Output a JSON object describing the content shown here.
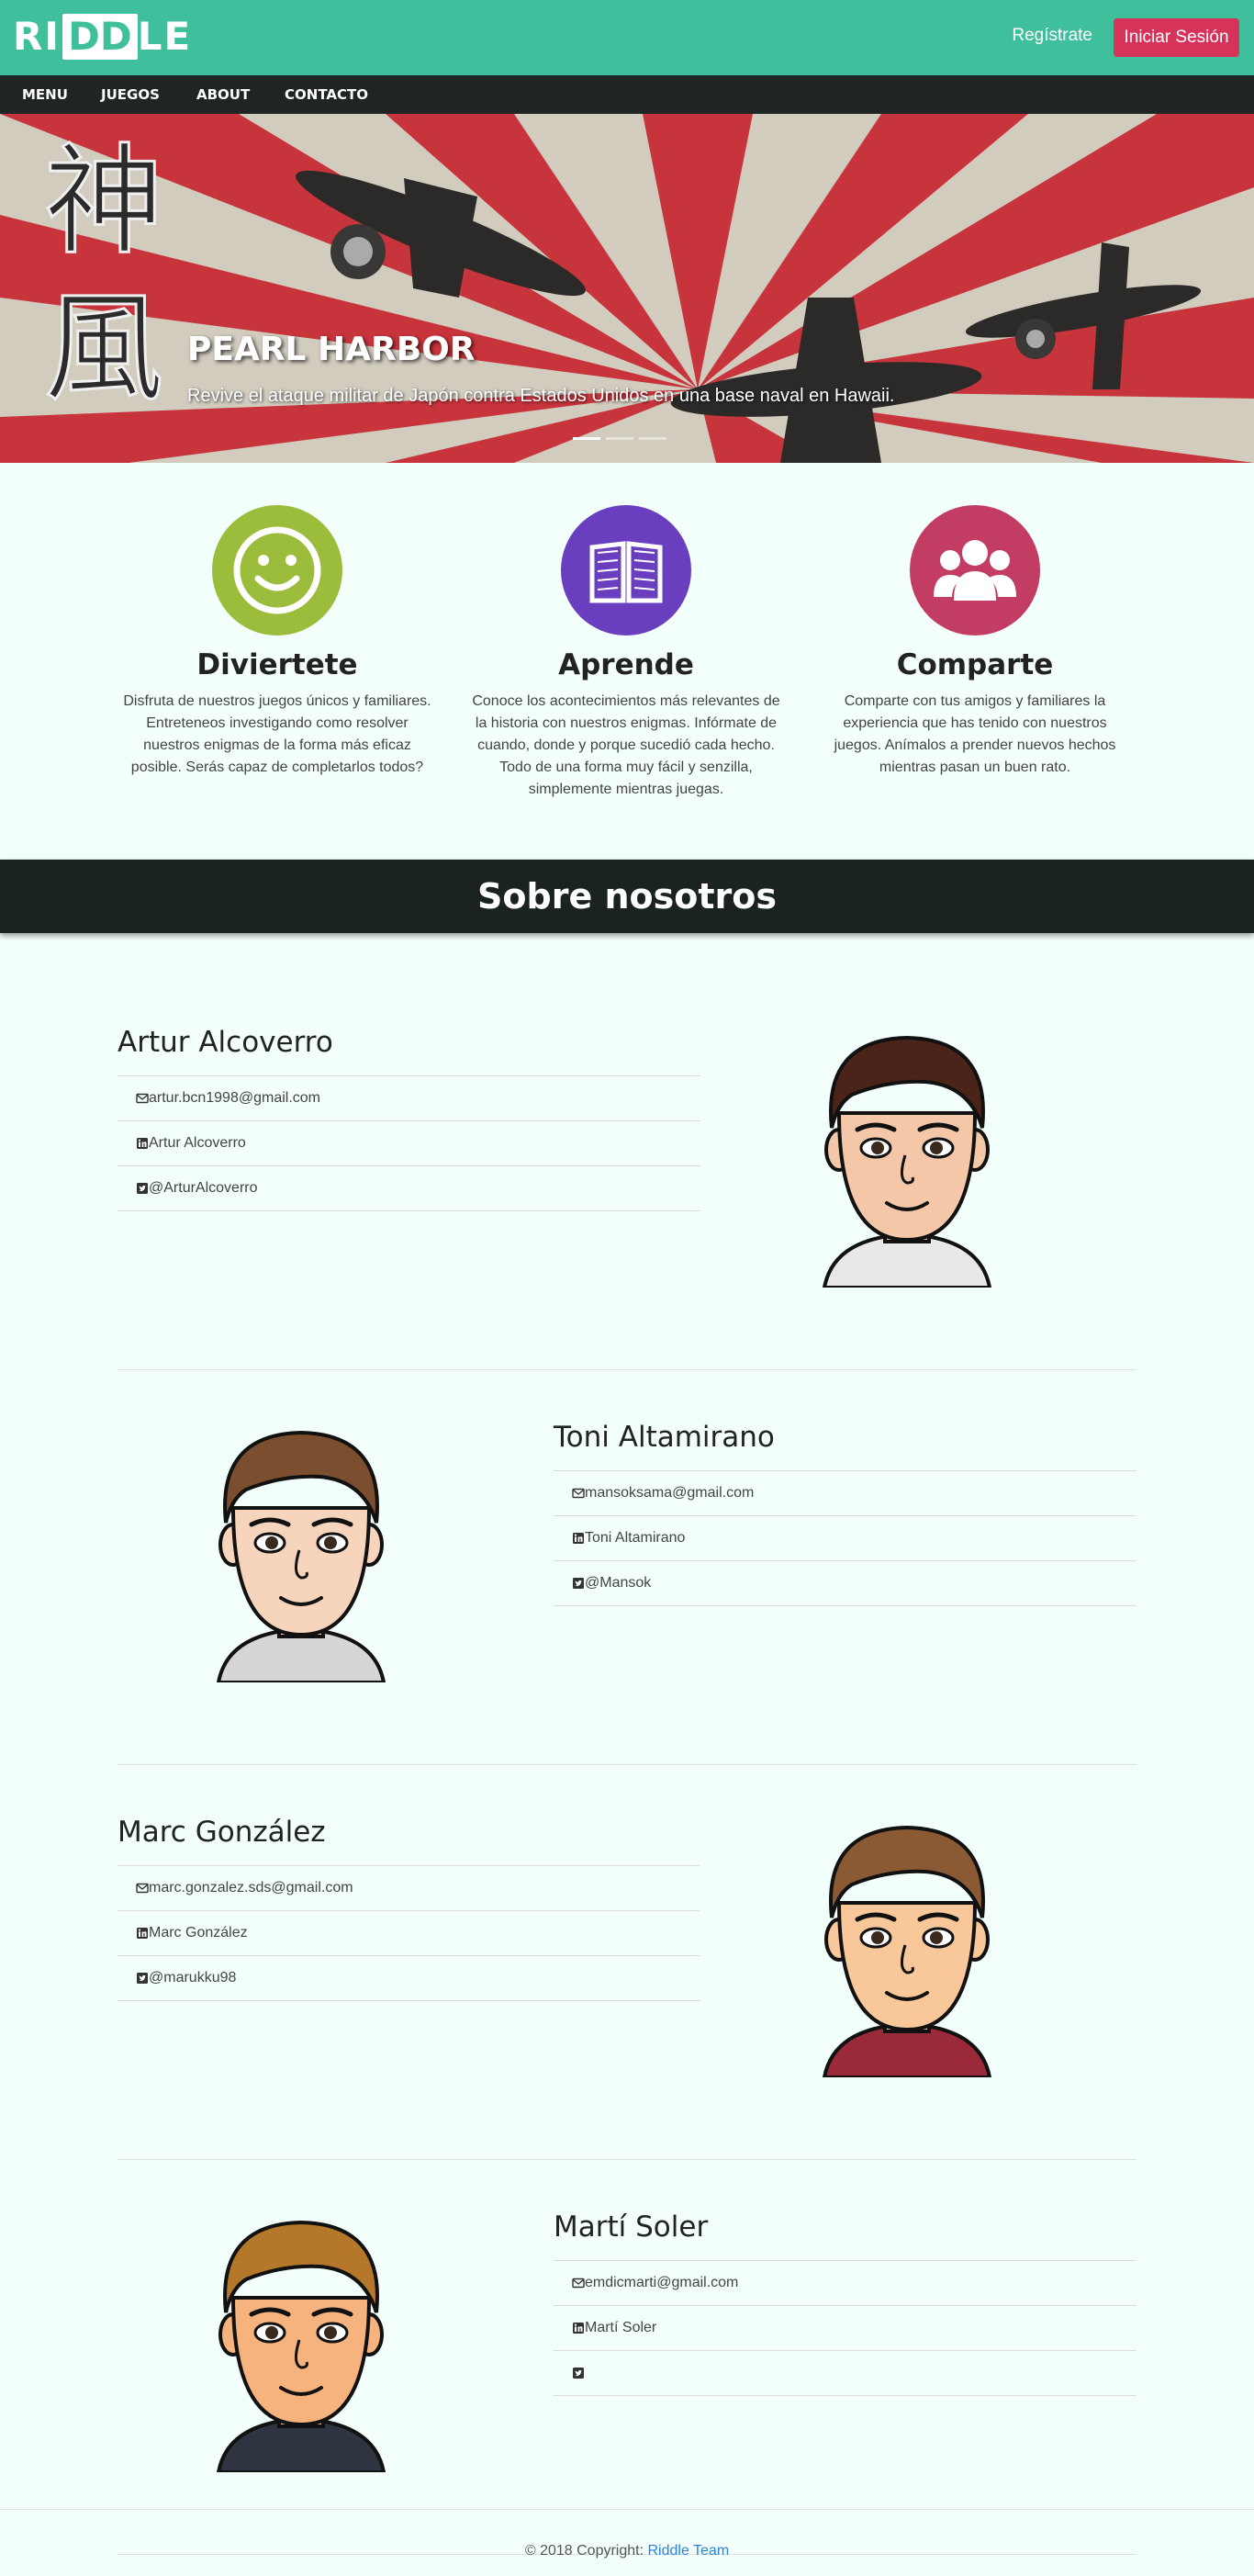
{
  "header": {
    "logo": "RIDDLE",
    "register_label": "Regístrate",
    "login_label": "Iniciar Sesión"
  },
  "nav": {
    "items": [
      {
        "label": "MENU"
      },
      {
        "label": "JUEGOS"
      },
      {
        "label": "ABOUT"
      },
      {
        "label": "CONTACTO"
      }
    ]
  },
  "hero": {
    "title": "PEARL HARBOR",
    "subtitle": "Revive el ataque militar de Japón contra Estados Unidos en una base naval en Hawaii.",
    "kanji_top": "神",
    "kanji_bottom": "風",
    "slides": 3,
    "active_slide": 1
  },
  "features": [
    {
      "title": "Diviertete",
      "text": "Disfruta de nuestros juegos únicos y familiares. Entreteneos investigando como resolver nuestros enigmas de la forma más eficaz posible. Serás capaz de completarlos todos?",
      "color": "#9cbc3c",
      "icon": "smiley-icon"
    },
    {
      "title": "Aprende",
      "text": "Conoce los acontecimientos más relevantes de la historia con nuestros enigmas. Infórmate de cuando, donde y porque sucedió cada hecho. Todo de una forma muy fácil y senzilla, simplemente mientras juegas.",
      "color": "#6a3fbf",
      "icon": "book-icon"
    },
    {
      "title": "Comparte",
      "text": "Comparte con tus amigos y familiares la experiencia que has tenido con nuestros juegos. Anímalos a prender nuevos hechos mientras pasan un buen rato.",
      "color": "#c33c64",
      "icon": "group-icon"
    }
  ],
  "about": {
    "title": "Sobre nosotros"
  },
  "members": [
    {
      "name": "Artur Alcoverro",
      "email": "artur.bcn1998@gmail.com",
      "linkedin": "Artur Alcoverro",
      "twitter": "@ArturAlcoverro",
      "hair": "#4a2418",
      "skin": "#f3c7a8"
    },
    {
      "name": "Toni Altamirano",
      "email": "mansoksama@gmail.com",
      "linkedin": "Toni Altamirano",
      "twitter": "@Mansok",
      "hair": "#7a4e2e",
      "skin": "#f7d4bc"
    },
    {
      "name": "Marc González",
      "email": "marc.gonzalez.sds@gmail.com",
      "linkedin": "Marc González",
      "twitter": "@marukku98",
      "hair": "#8a5a34",
      "skin": "#f8c79a"
    },
    {
      "name": "Martí Soler",
      "email": "emdicmarti@gmail.com",
      "linkedin": "Martí Soler",
      "twitter": "",
      "hair": "#b5782a",
      "skin": "#f7b37e"
    }
  ],
  "footer": {
    "text": "© 2018 Copyright:",
    "link": "Riddle Team"
  }
}
